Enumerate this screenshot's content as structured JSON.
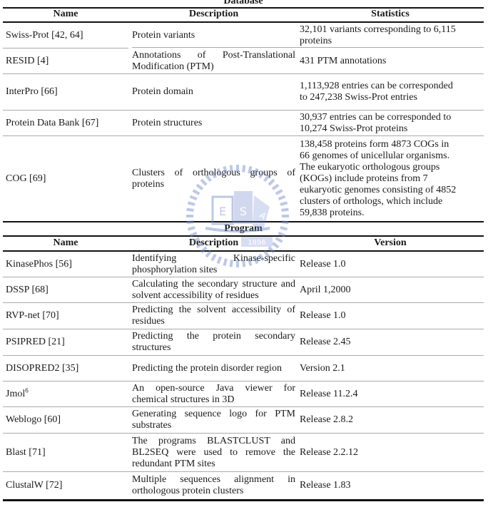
{
  "database_section": {
    "title": "Database",
    "headers": [
      "Name",
      "Description",
      "Statistics"
    ],
    "rows": [
      {
        "name": "Swiss-Prot [42, 64]",
        "description": "Protein variants",
        "statistics": "32,101 variants corresponding to 6,115 proteins"
      },
      {
        "name": "RESID [4]",
        "description": "Annotations of Post-Translational Modification (PTM)",
        "statistics": "431 PTM annotations"
      },
      {
        "name": "InterPro [66]",
        "description": "Protein domain",
        "statistics": "1,113,928 entries can be corresponded to 247,238 Swiss-Prot entries"
      },
      {
        "name": "Protein Data Bank [67]",
        "description": "Protein structures",
        "statistics": "30,937 entries can be corresponded to 10,274 Swiss-Prot proteins"
      },
      {
        "name": "COG [69]",
        "description": "Clusters of orthologous groups of proteins",
        "statistics": "138,458 proteins form 4873 COGs in 66 genomes of unicellular organisms. The eukaryotic orthologous groups (KOGs) include proteins from 7 eukaryotic genomes consisting of 4852 clusters of orthologs, which include 59,838 proteins."
      }
    ]
  },
  "program_section": {
    "title": "Program",
    "headers": [
      "Name",
      "Description",
      "Version"
    ],
    "rows": [
      {
        "name": "KinasePhos [56]",
        "description": "Identifying Kinase-specific phosphorylation sites",
        "version": "Release 1.0"
      },
      {
        "name": "DSSP [68]",
        "description": "Calculating the secondary structure and solvent accessibility of residues",
        "version": "April 1,2000"
      },
      {
        "name": "RVP-net [70]",
        "description": "Predicting the solvent accessibility of residues",
        "version": "Release 1.0"
      },
      {
        "name": "PSIPRED [21]",
        "description": "Predicting the protein secondary structures",
        "version": "Release 2.45"
      },
      {
        "name": "DISOPRED2 [35]",
        "description": "Predicting the protein disorder region",
        "version": "Version 2.1"
      },
      {
        "name": "Jmol",
        "name_superscript": "6",
        "description": "An open-source Java viewer for chemical structures in 3D",
        "version": "Release 11.2.4"
      },
      {
        "name": "Weblogo [60]",
        "description": "Generating sequence logo for PTM substrates",
        "version": "Release 2.8.2"
      },
      {
        "name": "Blast [71]",
        "description": "The programs BLASTCLUST and BL2SEQ were used to remove the redundant PTM sites",
        "version": "Release 2.2.12"
      },
      {
        "name": "ClustalW [72]",
        "description": "Multiple sequences alignment in orthologous protein clusters",
        "version": "Release 1.83"
      }
    ]
  },
  "watermark": {
    "icon": "university-seal-icon",
    "text": "1896",
    "letters": [
      "E",
      "S",
      "A"
    ],
    "color": "#6f86c9"
  }
}
